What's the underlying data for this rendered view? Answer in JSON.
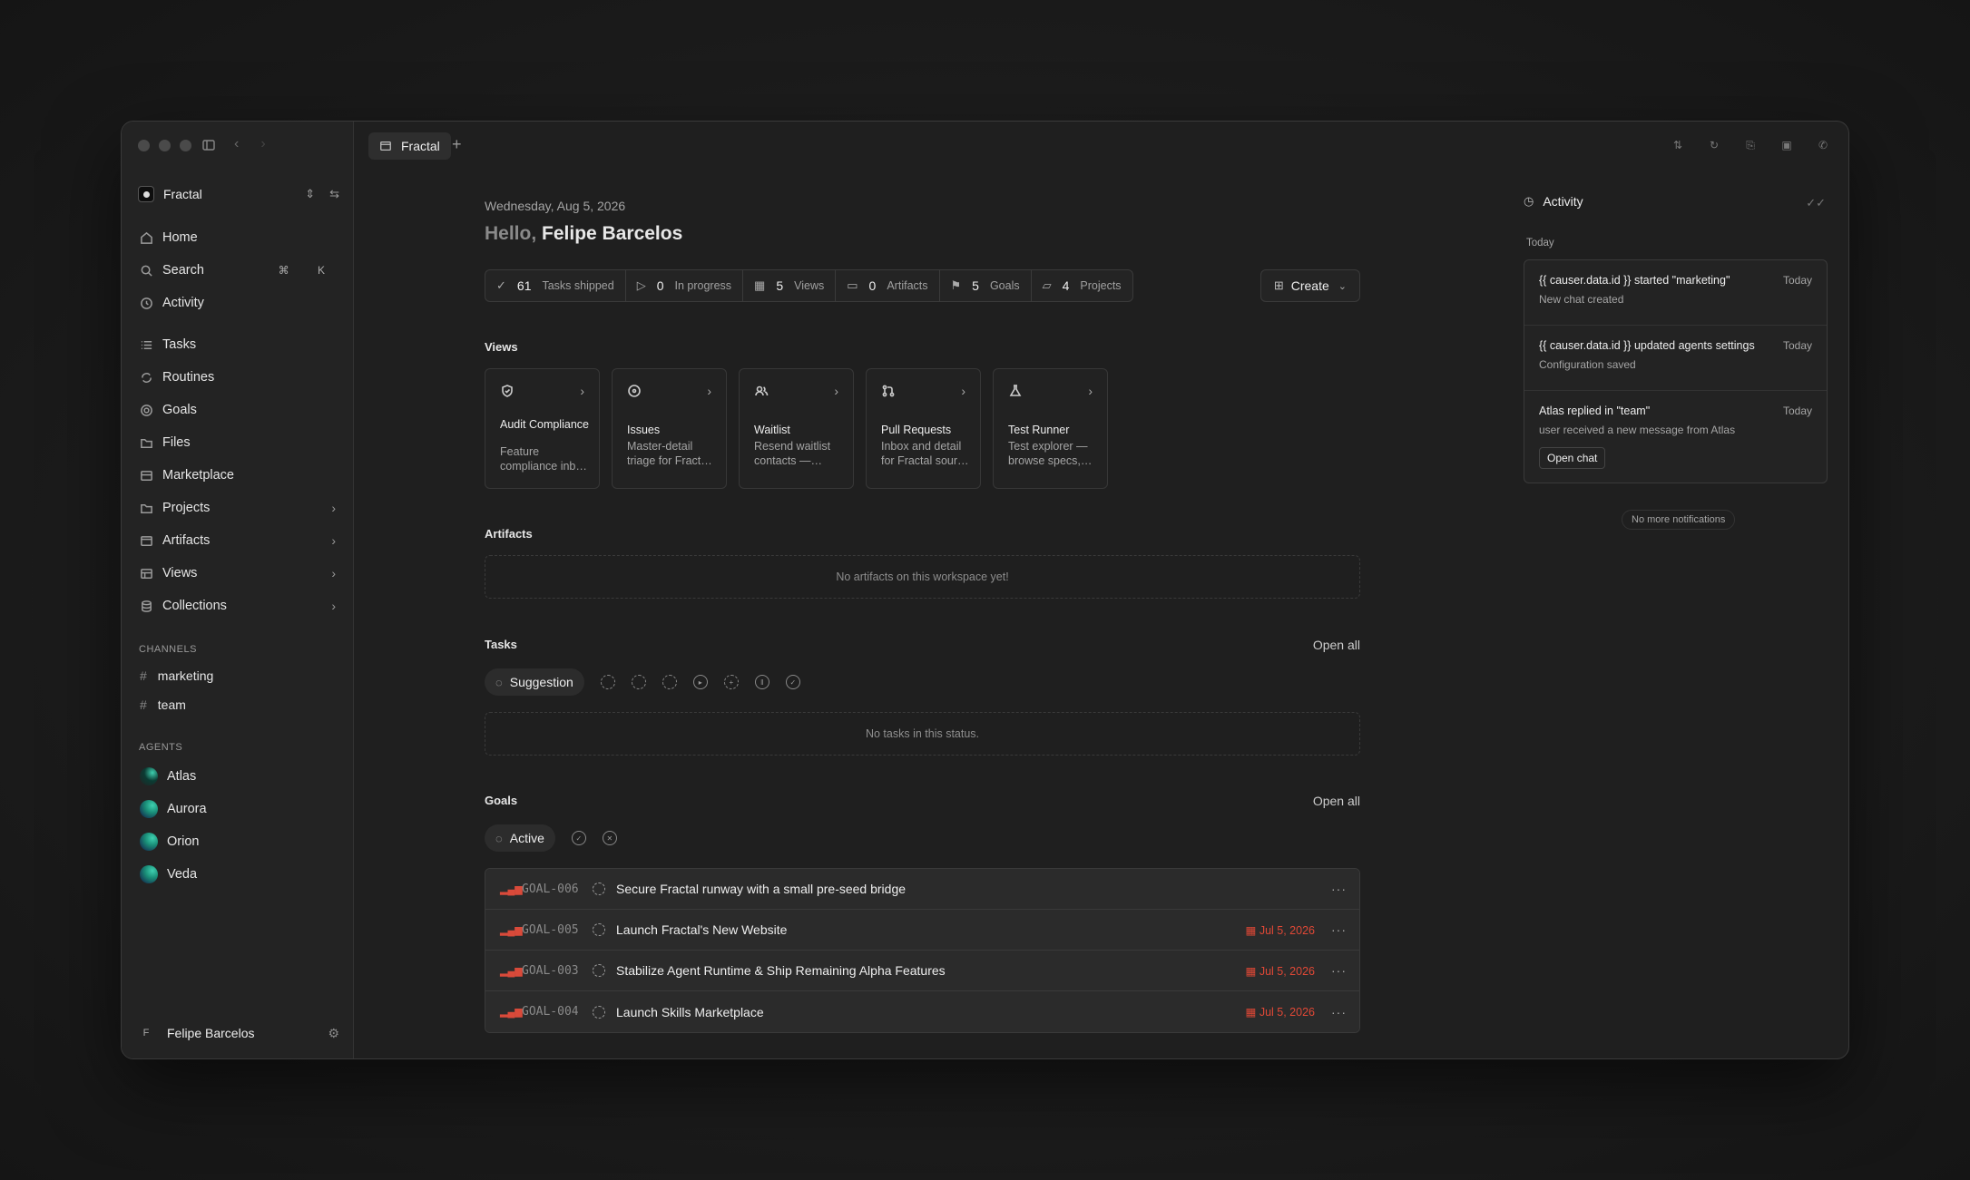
{
  "workspace": {
    "name": "Fractal"
  },
  "sidebar": {
    "nav_primary": [
      {
        "label": "Home",
        "icon": "home-icon"
      },
      {
        "label": "Search",
        "icon": "search-icon",
        "shortcut": "⌘ K"
      },
      {
        "label": "Activity",
        "icon": "clock-icon"
      }
    ],
    "nav_secondary": [
      {
        "label": "Tasks",
        "icon": "list-icon"
      },
      {
        "label": "Routines",
        "icon": "loop-icon"
      },
      {
        "label": "Goals",
        "icon": "target-icon"
      },
      {
        "label": "Files",
        "icon": "folder-icon"
      },
      {
        "label": "Marketplace",
        "icon": "store-icon"
      },
      {
        "label": "Projects",
        "icon": "folder-icon",
        "expandable": true
      },
      {
        "label": "Artifacts",
        "icon": "window-icon",
        "expandable": true
      },
      {
        "label": "Views",
        "icon": "table-icon",
        "expandable": true
      },
      {
        "label": "Collections",
        "icon": "database-icon",
        "expandable": true
      }
    ],
    "channels_label": "CHANNELS",
    "channels": [
      "marketing",
      "team"
    ],
    "agents_label": "AGENTS",
    "agents": [
      "Atlas",
      "Aurora",
      "Orion",
      "Veda"
    ],
    "user": {
      "initial": "F",
      "name": "Felipe Barcelos"
    }
  },
  "tabs": [
    {
      "label": "Fractal"
    }
  ],
  "main": {
    "date": "Wednesday, Aug 5, 2026",
    "greeting": "Hello,",
    "user_name": "Felipe Barcelos",
    "stats": [
      {
        "value": "61",
        "label": "Tasks shipped",
        "icon": "check-circle-icon"
      },
      {
        "value": "0",
        "label": "In progress",
        "icon": "play-circle-icon"
      },
      {
        "value": "5",
        "label": "Views",
        "icon": "grid-icon"
      },
      {
        "value": "0",
        "label": "Artifacts",
        "icon": "window-icon"
      },
      {
        "value": "5",
        "label": "Goals",
        "icon": "flag-icon"
      },
      {
        "value": "4",
        "label": "Projects",
        "icon": "folder-icon"
      }
    ],
    "create_label": "Create",
    "views_heading": "Views",
    "views": [
      {
        "title": "Audit Compliance",
        "desc": "Feature compliance inb…",
        "icon": "shield-check-icon"
      },
      {
        "title": "Issues",
        "desc": "Master-detail triage for Fract…",
        "icon": "target-icon"
      },
      {
        "title": "Waitlist",
        "desc": "Resend waitlist contacts —…",
        "icon": "users-icon"
      },
      {
        "title": "Pull Requests",
        "desc": "Inbox and detail for Fractal sour…",
        "icon": "git-pull-request-icon"
      },
      {
        "title": "Test Runner",
        "desc": "Test explorer — browse specs,…",
        "icon": "flask-icon"
      }
    ],
    "artifacts_heading": "Artifacts",
    "artifacts_empty": "No artifacts on this workspace yet!",
    "tasks_heading": "Tasks",
    "tasks_open_all": "Open all",
    "tasks_filter_active": "Suggestion",
    "tasks_empty": "No tasks in this status.",
    "goals_heading": "Goals",
    "goals_open_all": "Open all",
    "goals_filter_active": "Active",
    "goals": [
      {
        "id": "GOAL-006",
        "title": "Secure Fractal runway with a small pre-seed bridge",
        "due": ""
      },
      {
        "id": "GOAL-005",
        "title": "Launch Fractal's New Website",
        "due": "Jul 5, 2026"
      },
      {
        "id": "GOAL-003",
        "title": "Stabilize Agent Runtime & Ship Remaining Alpha Features",
        "due": "Jul 5, 2026"
      },
      {
        "id": "GOAL-004",
        "title": "Launch Skills Marketplace",
        "due": "Jul 5, 2026"
      }
    ]
  },
  "activity": {
    "title": "Activity",
    "group_label": "Today",
    "items": [
      {
        "title": "{{ causer.data.id }} started \"marketing\"",
        "desc": "New chat created",
        "when": "Today"
      },
      {
        "title": "{{ causer.data.id }} updated agents settings",
        "desc": "Configuration saved",
        "when": "Today"
      },
      {
        "title": "Atlas replied in \"team\"",
        "desc": "user received a new message from Atlas",
        "when": "Today",
        "action": "Open chat"
      }
    ],
    "footer": "No more notifications"
  },
  "colors": {
    "accent_red": "#e04836",
    "agent_teal": "#3fd0b0"
  }
}
